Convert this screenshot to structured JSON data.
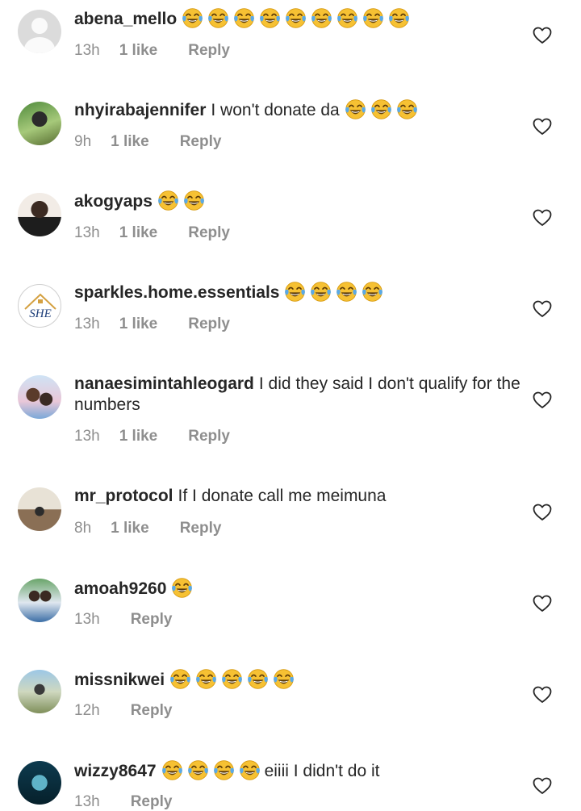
{
  "comments": [
    {
      "username": "abena_mello",
      "text": "",
      "emoji_count": 9,
      "text_after": "",
      "time": "13h",
      "likes": "1 like",
      "reply": "Reply",
      "avatar": "default"
    },
    {
      "username": "nhyirabajennifer",
      "text": "I won't donate da",
      "emoji_count": 3,
      "text_after": "",
      "time": "9h",
      "likes": "1 like",
      "reply": "Reply",
      "avatar": "photo-green"
    },
    {
      "username": "akogyaps",
      "text": "",
      "emoji_count": 2,
      "text_after": "",
      "time": "13h",
      "likes": "1 like",
      "reply": "Reply",
      "avatar": "photo-dark"
    },
    {
      "username": "sparkles.home.essentials",
      "text": "",
      "emoji_count": 4,
      "text_after": "",
      "time": "13h",
      "likes": "1 like",
      "reply": "Reply",
      "avatar": "logo-she"
    },
    {
      "username": "nanaesimintahleogard",
      "text": "I did they said I don't qualify for the numbers",
      "emoji_count": 0,
      "text_after": "",
      "time": "13h",
      "likes": "1 like",
      "reply": "Reply",
      "avatar": "photo-family"
    },
    {
      "username": "mr_protocol",
      "text": "If I donate call me meimuna",
      "emoji_count": 0,
      "text_after": "",
      "time": "8h",
      "likes": "1 like",
      "reply": "Reply",
      "avatar": "photo-beach"
    },
    {
      "username": "amoah9260",
      "text": "",
      "emoji_count": 1,
      "text_after": "",
      "time": "13h",
      "likes": "",
      "reply": "Reply",
      "avatar": "photo-couple"
    },
    {
      "username": "missnikwei",
      "text": "",
      "emoji_count": 5,
      "text_after": "",
      "time": "12h",
      "likes": "",
      "reply": "Reply",
      "avatar": "photo-outdoor"
    },
    {
      "username": "wizzy8647",
      "text": "",
      "emoji_count": 4,
      "text_after": "eiiii I didn't  do it",
      "time": "13h",
      "likes": "",
      "reply": "Reply",
      "avatar": "photo-night"
    }
  ],
  "icons": {
    "emoji": "face-with-tears-of-joy-icon",
    "like": "heart-outline-icon"
  },
  "colors": {
    "text": "#262626",
    "meta": "#8e8e8e",
    "emoji_face": "#f6c133",
    "tears": "#5aa9e6"
  }
}
